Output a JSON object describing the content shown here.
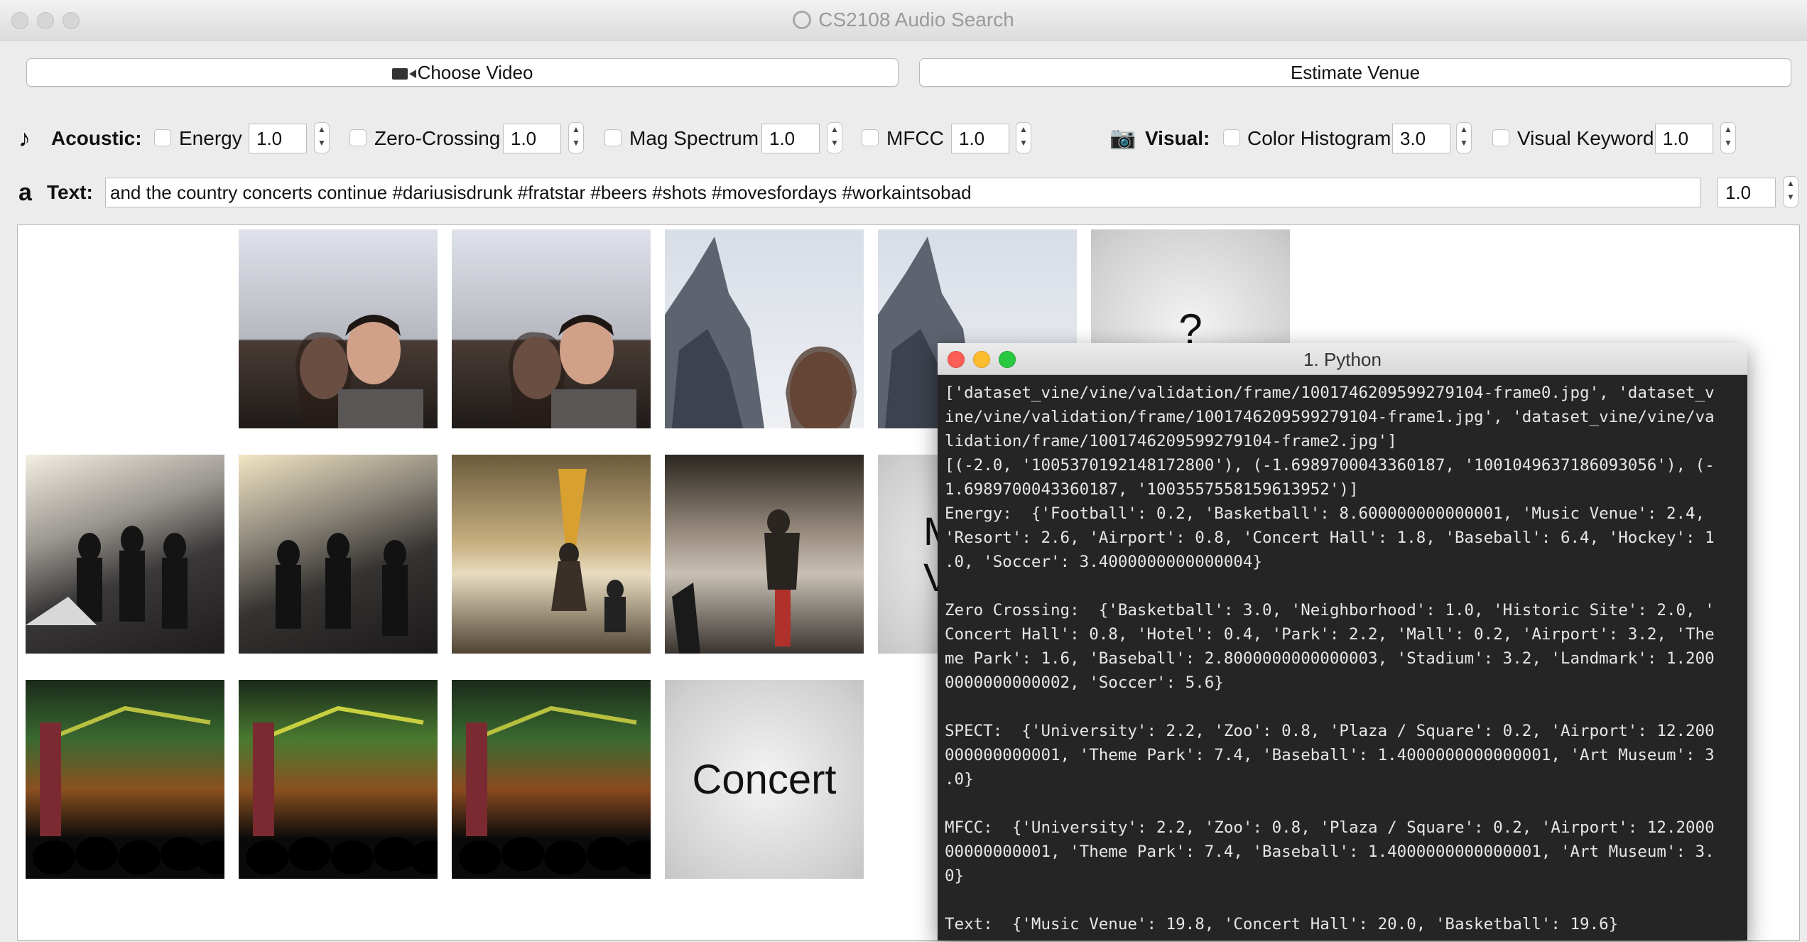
{
  "window": {
    "title": "CS2108 Audio Search"
  },
  "toolbar": {
    "choose_video": "Choose Video",
    "estimate_venue": "Estimate Venue"
  },
  "acoustic": {
    "label": "Acoustic:",
    "icon": "music-note-icon",
    "features": [
      {
        "name": "Energy",
        "value": "1.0"
      },
      {
        "name": "Zero-Crossing",
        "value": "1.0"
      },
      {
        "name": "Mag Spectrum",
        "value": "1.0"
      },
      {
        "name": "MFCC",
        "value": "1.0"
      }
    ]
  },
  "visual": {
    "label": "Visual:",
    "icon": "camera-icon",
    "features": [
      {
        "name": "Color Histogram",
        "value": "3.0"
      },
      {
        "name": "Visual Keyword",
        "value": "1.0"
      }
    ]
  },
  "text": {
    "icon_glyph": "a",
    "label": "Text:",
    "value": "and the country concerts continue #dariusisdrunk #fratstar #beers #shots #movesfordays #workaintsobad",
    "weight": "1.0"
  },
  "results": {
    "placeholder_question": "?",
    "placeholder_music": "Music Venue",
    "placeholder_concert": "Concert"
  },
  "terminal": {
    "title": "1. Python",
    "lines": [
      "['dataset_vine/vine/validation/frame/1001746209599279104-frame0.jpg', 'dataset_v",
      "ine/vine/validation/frame/1001746209599279104-frame1.jpg', 'dataset_vine/vine/va",
      "lidation/frame/1001746209599279104-frame2.jpg']",
      "[(-2.0, '1005370192148172800'), (-1.6989700043360187, '1001049637186093056'), (-",
      "1.6989700043360187, '1003557558159613952')]",
      "Energy:  {'Football': 0.2, 'Basketball': 8.600000000000001, 'Music Venue': 2.4,",
      "'Resort': 2.6, 'Airport': 0.8, 'Concert Hall': 1.8, 'Baseball': 6.4, 'Hockey': 1",
      ".0, 'Soccer': 3.4000000000000004}",
      "",
      "Zero Crossing:  {'Basketball': 3.0, 'Neighborhood': 1.0, 'Historic Site': 2.0, '",
      "Concert Hall': 0.8, 'Hotel': 0.4, 'Park': 2.2, 'Mall': 0.2, 'Airport': 3.2, 'The",
      "me Park': 1.6, 'Baseball': 2.8000000000000003, 'Stadium': 3.2, 'Landmark': 1.200",
      "0000000000002, 'Soccer': 5.6}",
      "",
      "SPECT:  {'University': 2.2, 'Zoo': 0.8, 'Plaza / Square': 0.2, 'Airport': 12.200",
      "000000000001, 'Theme Park': 7.4, 'Baseball': 1.4000000000000001, 'Art Museum': 3",
      ".0}",
      "",
      "MFCC:  {'University': 2.2, 'Zoo': 0.8, 'Plaza / Square': 0.2, 'Airport': 12.2000",
      "00000000001, 'Theme Park': 7.4, 'Baseball': 1.4000000000000001, 'Art Museum': 3.",
      "0}",
      "",
      "Text:  {'Music Venue': 19.8, 'Concert Hall': 20.0, 'Basketball': 19.6}"
    ]
  },
  "colors": {
    "terminal_bg": "#252525",
    "traffic_red": "#fc5f57",
    "traffic_yellow": "#fdbc2e",
    "traffic_green": "#28c840"
  }
}
